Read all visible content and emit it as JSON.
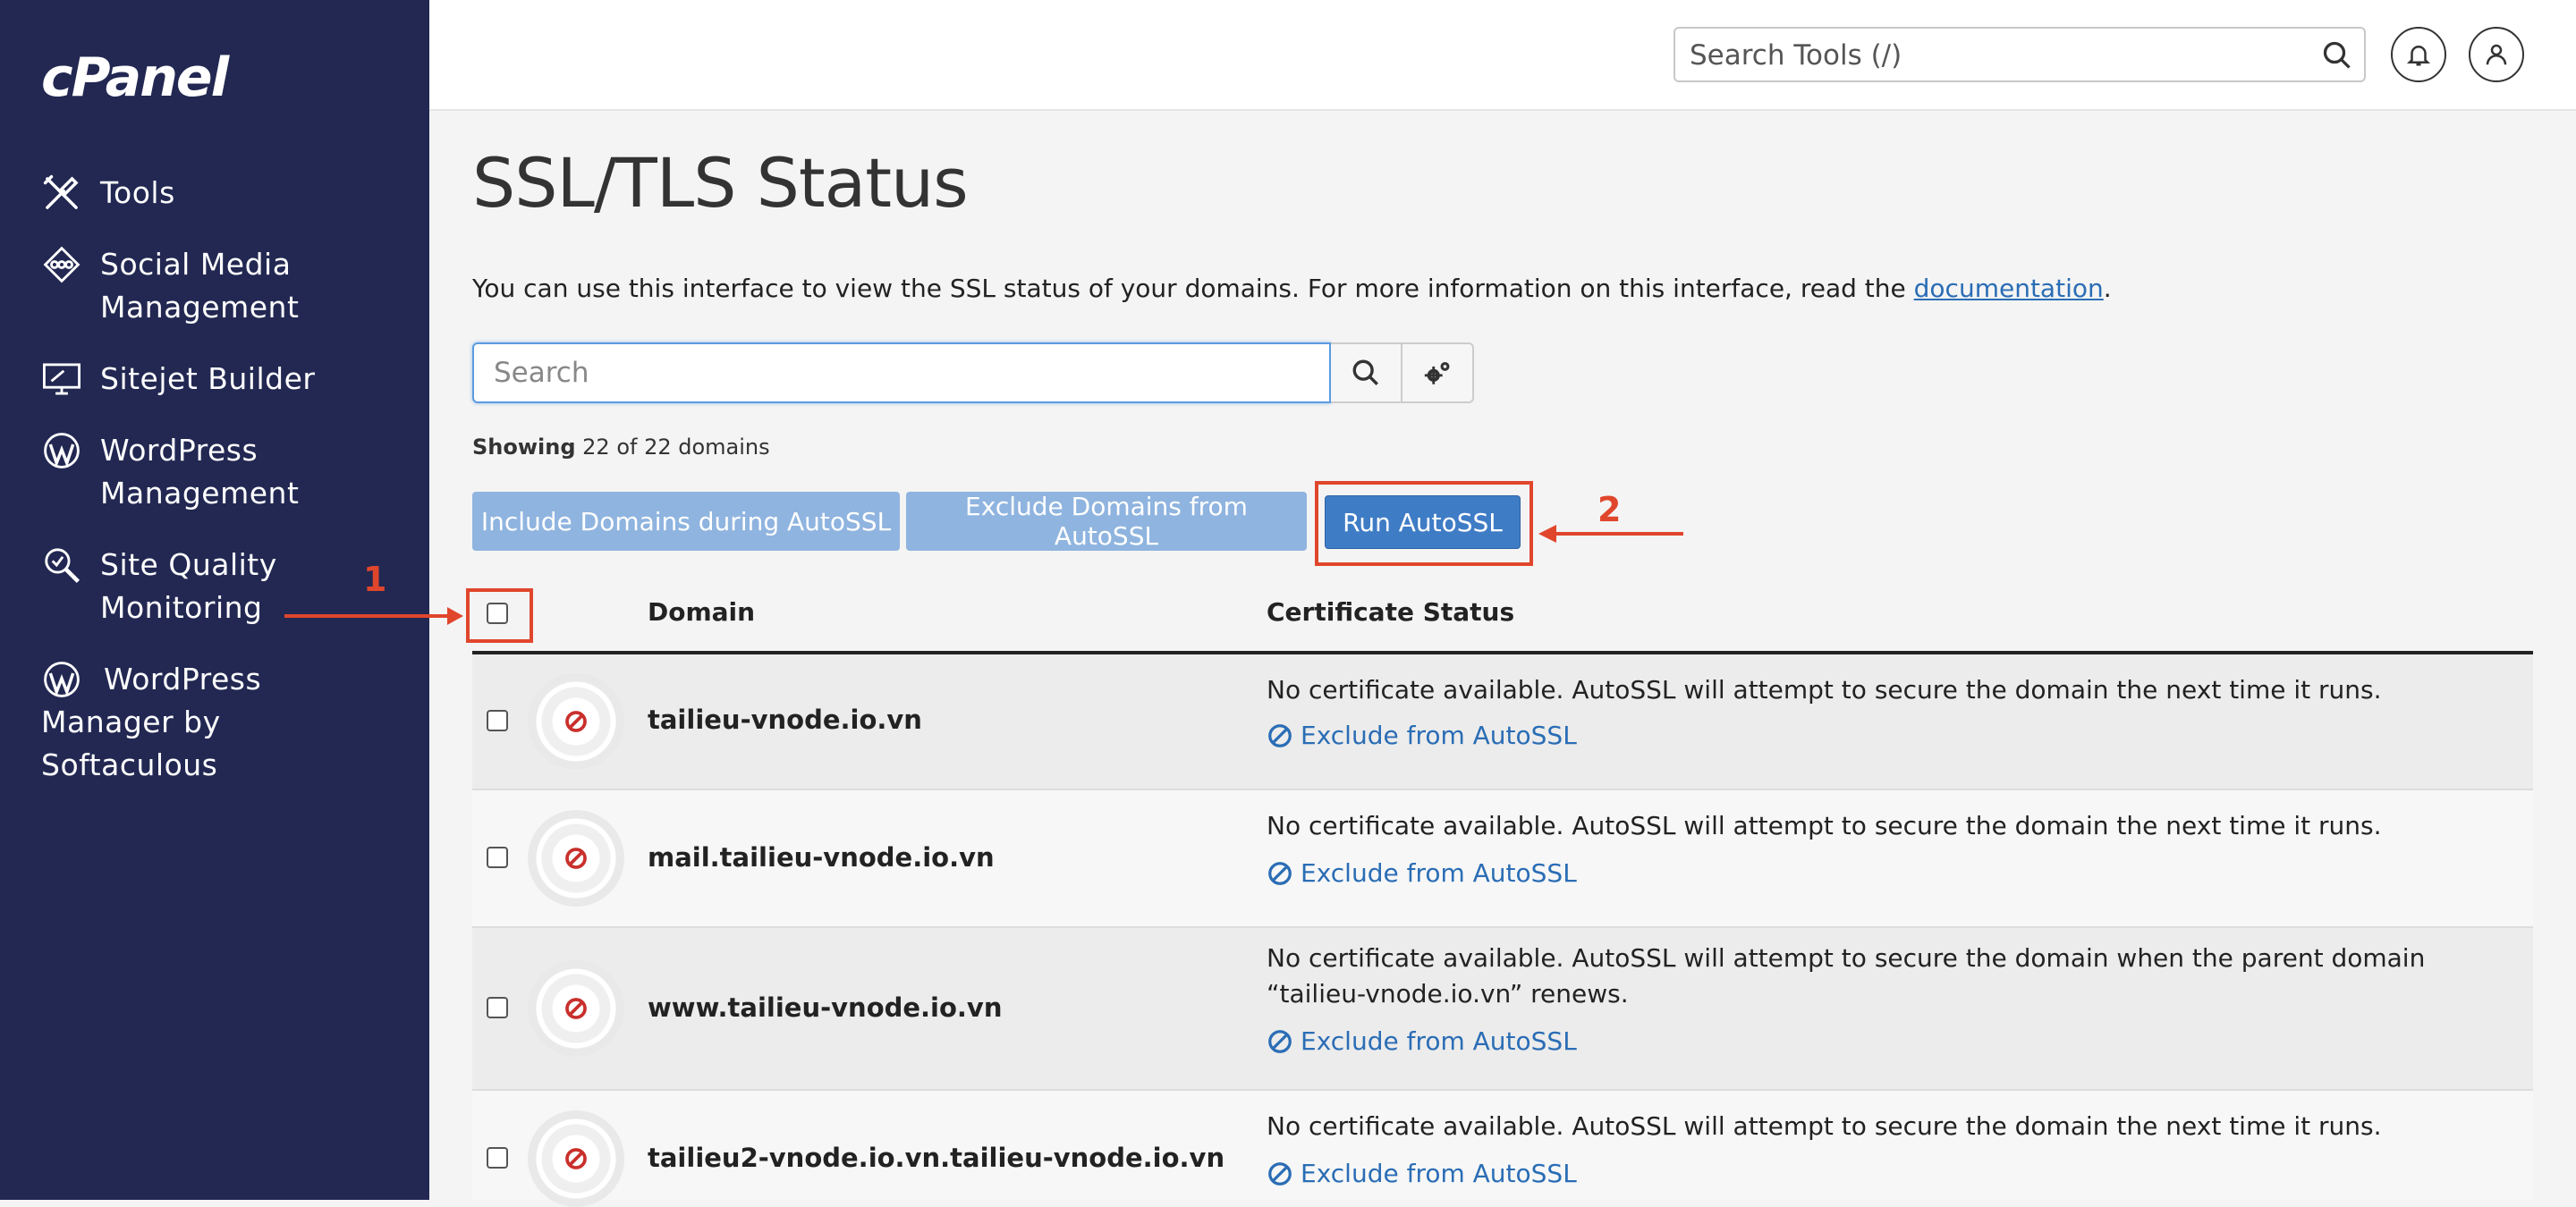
{
  "sidebar": {
    "logo": "cPanel",
    "items": [
      {
        "label": "Tools",
        "icon": "tools-icon"
      },
      {
        "label": "Social Media\nManagement",
        "icon": "social-media-icon"
      },
      {
        "label": "Sitejet Builder",
        "icon": "sitejet-icon"
      },
      {
        "label": "WordPress\nManagement",
        "icon": "wordpress-icon"
      },
      {
        "label": "Site Quality\nMonitoring",
        "icon": "site-quality-icon"
      },
      {
        "label": "WordPress\nManager by\nSoftaculous",
        "icon": "wordpress-icon"
      }
    ]
  },
  "header": {
    "search_placeholder": "Search Tools (/)",
    "icons": [
      "search-icon",
      "bell-icon",
      "user-icon"
    ]
  },
  "main": {
    "title": "SSL/TLS Status",
    "intro_before": "You can use this interface to view the SSL status of your domains. For more information on this interface, read the ",
    "intro_link": "documentation",
    "intro_after": ".",
    "search_placeholder": "Search",
    "showing_label": "Showing",
    "showing_value": " 22 of 22 domains",
    "buttons": {
      "include": "Include Domains during AutoSSL",
      "exclude": "Exclude Domains from AutoSSL",
      "run": "Run AutoSSL"
    },
    "annotations": {
      "one": "1",
      "two": "2"
    },
    "table": {
      "col_domain": "Domain",
      "col_status": "Certificate Status",
      "rows": [
        {
          "domain": "tailieu-vnode.io.vn",
          "status": "No certificate available. AutoSSL will attempt to secure the domain the next time it runs.",
          "action": "Exclude from AutoSSL"
        },
        {
          "domain": "mail.tailieu-vnode.io.vn",
          "status": "No certificate available. AutoSSL will attempt to secure the domain the next time it runs.",
          "action": "Exclude from AutoSSL"
        },
        {
          "domain": "www.tailieu-vnode.io.vn",
          "status": "No certificate available. AutoSSL will attempt to secure the domain when the parent domain “tailieu-vnode.io.vn” renews.",
          "action": "Exclude from AutoSSL"
        },
        {
          "domain": "tailieu2-vnode.io.vn.tailieu-vnode.io.vn",
          "status": "No certificate available. AutoSSL will attempt to secure the domain the next time it runs.",
          "action": "Exclude from AutoSSL"
        }
      ]
    }
  },
  "colors": {
    "sidebar_bg": "#222852",
    "link": "#2a6db5",
    "run_button": "#3f7cc6",
    "light_button": "#8fb4df",
    "annotation_red": "#e0462c",
    "status_red": "#c9302c"
  }
}
